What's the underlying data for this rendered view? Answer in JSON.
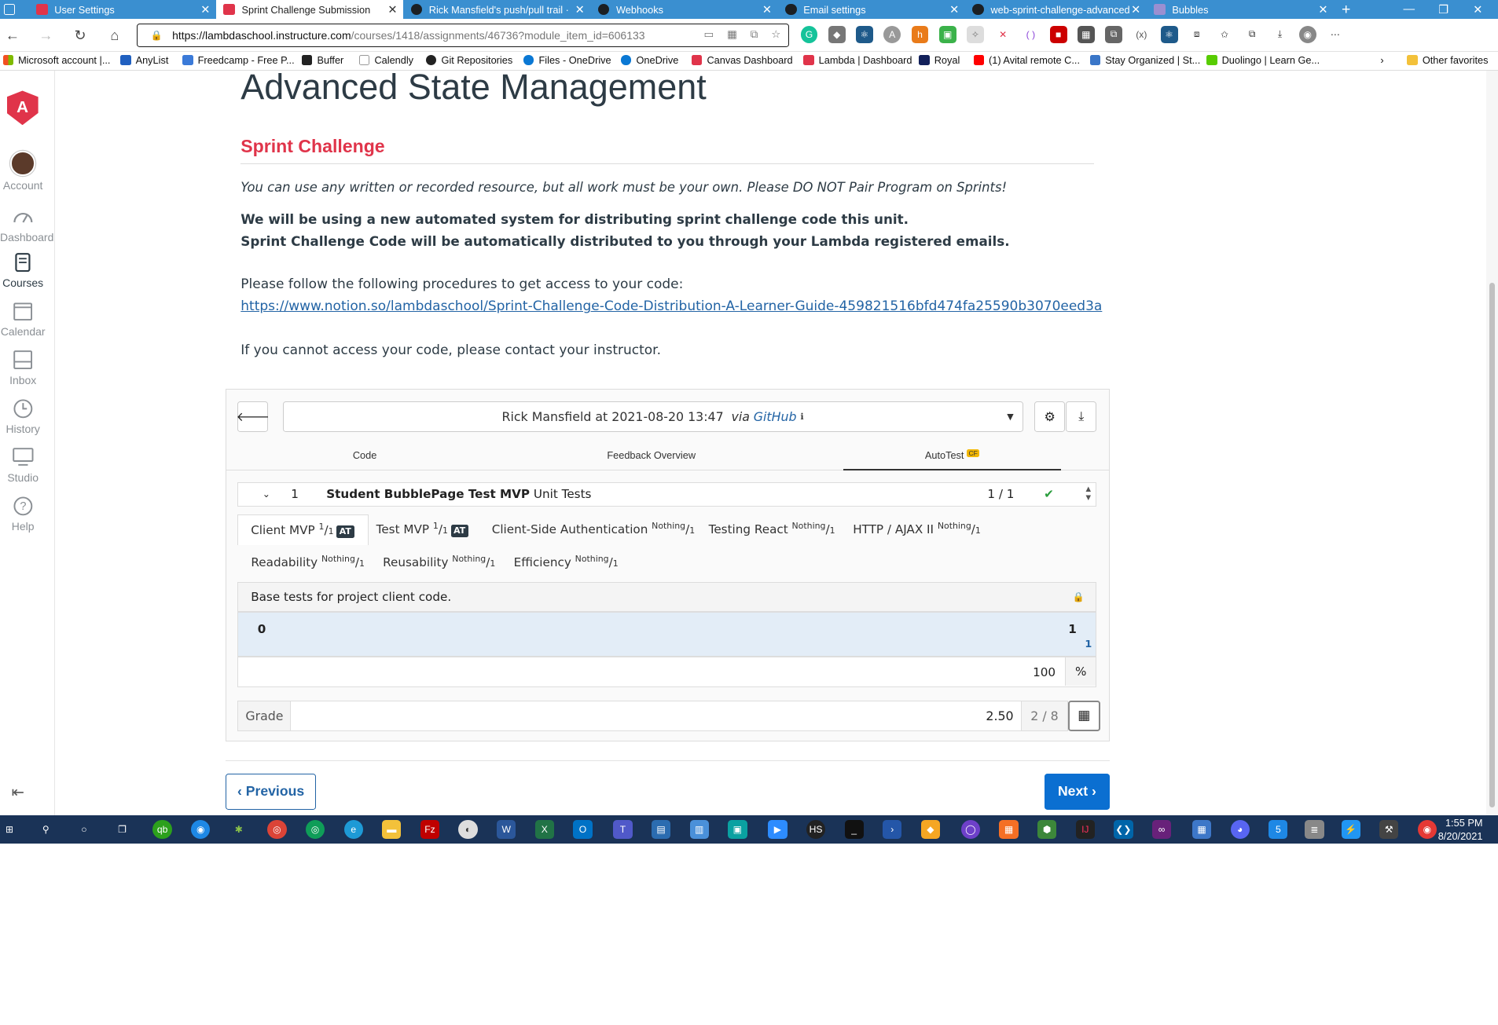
{
  "browser": {
    "tabs": [
      {
        "title": "User Settings",
        "active": false
      },
      {
        "title": "Sprint Challenge Submission",
        "active": true
      },
      {
        "title": "Rick Mansfield's push/pull trail ·",
        "active": false
      },
      {
        "title": "Webhooks",
        "active": false
      },
      {
        "title": "Email settings",
        "active": false
      },
      {
        "title": "web-sprint-challenge-advanced",
        "active": false
      },
      {
        "title": "Bubbles",
        "active": false
      }
    ],
    "url_host": "https://lambdaschool.instructure.com",
    "url_path": "/courses/1418/assignments/46736?module_item_id=606133",
    "bookmarks": [
      "Microsoft account |...",
      "AnyList",
      "Freedcamp - Free P...",
      "Buffer",
      "Calendly",
      "Git Repositories",
      "Files - OneDrive",
      "OneDrive",
      "Canvas Dashboard",
      "Lambda | Dashboard",
      "Royal",
      "(1) Avital remote C...",
      "Stay Organized | St...",
      "Duolingo | Learn Ge...",
      "Other favorites"
    ]
  },
  "nav": {
    "account": "Account",
    "dashboard": "Dashboard",
    "courses": "Courses",
    "calendar": "Calendar",
    "inbox": "Inbox",
    "history": "History",
    "studio": "Studio",
    "help": "Help"
  },
  "content": {
    "title": "Advanced State Management",
    "section": "Sprint Challenge",
    "italic_note": "You can use any written or recorded resource, but all work must be your own. Please DO NOT Pair Program on Sprints!",
    "bold_1": "We will be using a new automated system for distributing sprint challenge code this unit.",
    "bold_2": "Sprint Challenge Code will be automatically distributed to you through your Lambda registered emails.",
    "follow": "Please follow the following procedures to get access to your code:",
    "link": "https://www.notion.so/lambdaschool/Sprint-Challenge-Code-Distribution-A-Learner-Guide-459821516bfd474fa25590b3070eed3a",
    "contact": "If you cannot access your code, please contact your instructor."
  },
  "submission": {
    "select_text": "Rick Mansfield at 2021-08-20 13:47",
    "via": "via",
    "source": "GitHub",
    "tabs": [
      "Code",
      "Feedback Overview",
      "AutoTest"
    ],
    "autotest_badge": "CF",
    "test_num": "1",
    "test_name": "Student BubblePage Test MVP",
    "test_kind": "Unit Tests",
    "test_score": "1 / 1",
    "categories": [
      {
        "name": "Client MVP",
        "score": "1",
        "total": "1",
        "badge": "AT"
      },
      {
        "name": "Test MVP",
        "score": "1",
        "total": "1",
        "badge": "AT"
      },
      {
        "name": "Client-Side Authentication",
        "score": "Nothing",
        "total": "1"
      },
      {
        "name": "Testing React",
        "score": "Nothing",
        "total": "1"
      },
      {
        "name": "HTTP / AJAX II",
        "score": "Nothing",
        "total": "1"
      },
      {
        "name": "Readability",
        "score": "Nothing",
        "total": "1"
      },
      {
        "name": "Reusability",
        "score": "Nothing",
        "total": "1"
      },
      {
        "name": "Efficiency",
        "score": "Nothing",
        "total": "1"
      }
    ],
    "description": "Base tests for project client code.",
    "meter_min": "0",
    "meter_max": "1",
    "meter_value": "1",
    "percent": "100",
    "percent_unit": "%",
    "grade_label": "Grade",
    "grade_value": "2.50",
    "grade_fraction": "2 / 8"
  },
  "footer": {
    "prev": "‹ Previous",
    "next": "Next ›"
  },
  "taskbar": {
    "time": "1:55 PM",
    "date": "8/20/2021"
  },
  "colors": {
    "accent": "#e0344a",
    "link": "#2364a5",
    "next_button": "#0b6fd1",
    "tabbar": "#3a8fd0",
    "taskbar": "#1a3357"
  }
}
